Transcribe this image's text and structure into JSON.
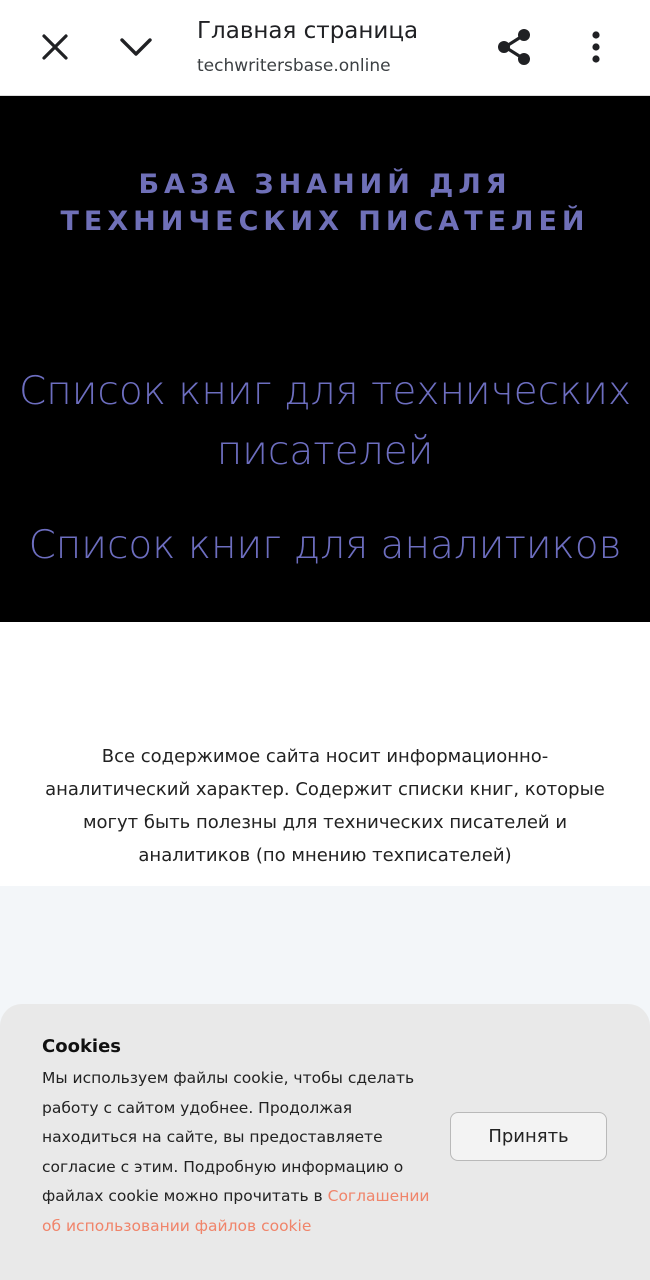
{
  "browser": {
    "title": "Главная страница",
    "url": "techwritersbase.online",
    "icons": [
      "close-icon",
      "chevron-down-icon",
      "share-icon",
      "more-vert-icon"
    ]
  },
  "hero": {
    "site_name_line1": "БАЗА ЗНАНИЙ ДЛЯ",
    "site_name_line2": "ТЕХНИЧЕСКИХ ПИСАТЕЛЕЙ",
    "link_tech_writers_line1": "Список книг для технических",
    "link_tech_writers_line2": "писателей",
    "link_analysts": "Список книг для аналитиков"
  },
  "description": {
    "line1": "Все содержимое сайта носит информационно-",
    "line2": "аналитический характер. Содержит списки книг, которые",
    "line3": "могут быть полезны для технических писателей и",
    "line4": "аналитиков (по мнению техписателей)"
  },
  "cookie_banner": {
    "title": "Cookies",
    "line1": "Мы используем файлы cookie, чтобы сделать",
    "line2": "работу с сайтом удобнее. Продолжая",
    "line3": "находиться на сайте, вы предоставляете",
    "line4": "согласие с этим. Подробную информацию о",
    "line5_text": "файлах cookie можно прочитать в ",
    "link_part1": "Соглашении",
    "link_part2": "об использовании файлов cookie",
    "accept_label": "Принять"
  },
  "colors": {
    "hero_bg": "#000000",
    "hero_text": "#6d6ec0",
    "cookie_link": "#f0846a",
    "cookie_bg": "#e9e9e9"
  }
}
